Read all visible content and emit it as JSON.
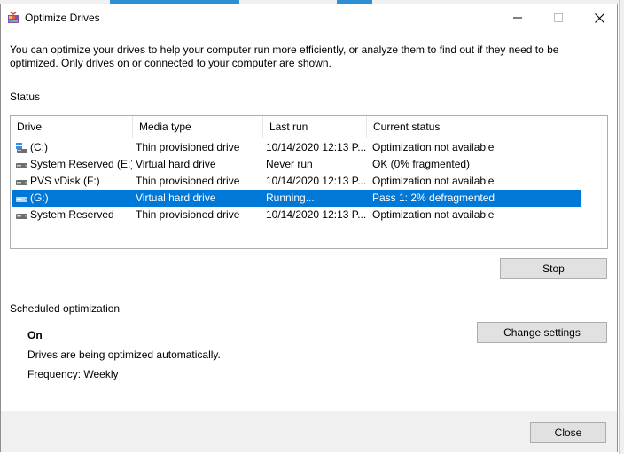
{
  "window": {
    "title": "Optimize Drives",
    "intro": "You can optimize your drives to help your computer run more efficiently, or analyze them to find out if they need to be optimized. Only drives on or connected to your computer are shown."
  },
  "status": {
    "label": "Status",
    "columns": [
      "Drive",
      "Media type",
      "Last run",
      "Current status"
    ],
    "rows": [
      {
        "drive": "(C:)",
        "media": "Thin provisioned drive",
        "last_run": "10/14/2020 12:13 P...",
        "status": "Optimization not available",
        "icon": "system-drive-icon",
        "selected": false
      },
      {
        "drive": "System Reserved (E:)",
        "media": "Virtual hard drive",
        "last_run": "Never run",
        "status": "OK (0% fragmented)",
        "icon": "drive-icon",
        "selected": false
      },
      {
        "drive": "PVS vDisk (F:)",
        "media": "Thin provisioned drive",
        "last_run": "10/14/2020 12:13 P...",
        "status": "Optimization not available",
        "icon": "drive-icon",
        "selected": false
      },
      {
        "drive": "(G:)",
        "media": "Virtual hard drive",
        "last_run": "Running...",
        "status": "Pass 1: 2% defragmented",
        "icon": "drive-icon",
        "selected": true
      },
      {
        "drive": "System Reserved",
        "media": "Thin provisioned drive",
        "last_run": "10/14/2020 12:13 P...",
        "status": "Optimization not available",
        "icon": "drive-icon",
        "selected": false
      }
    ],
    "stop_label": "Stop"
  },
  "scheduled": {
    "label": "Scheduled optimization",
    "state": "On",
    "description": "Drives are being optimized automatically.",
    "frequency": "Frequency: Weekly",
    "change_label": "Change settings"
  },
  "footer": {
    "close_label": "Close"
  },
  "colors": {
    "accent": "#0078d7",
    "button_bg": "#e1e1e1",
    "button_border": "#adadad"
  }
}
